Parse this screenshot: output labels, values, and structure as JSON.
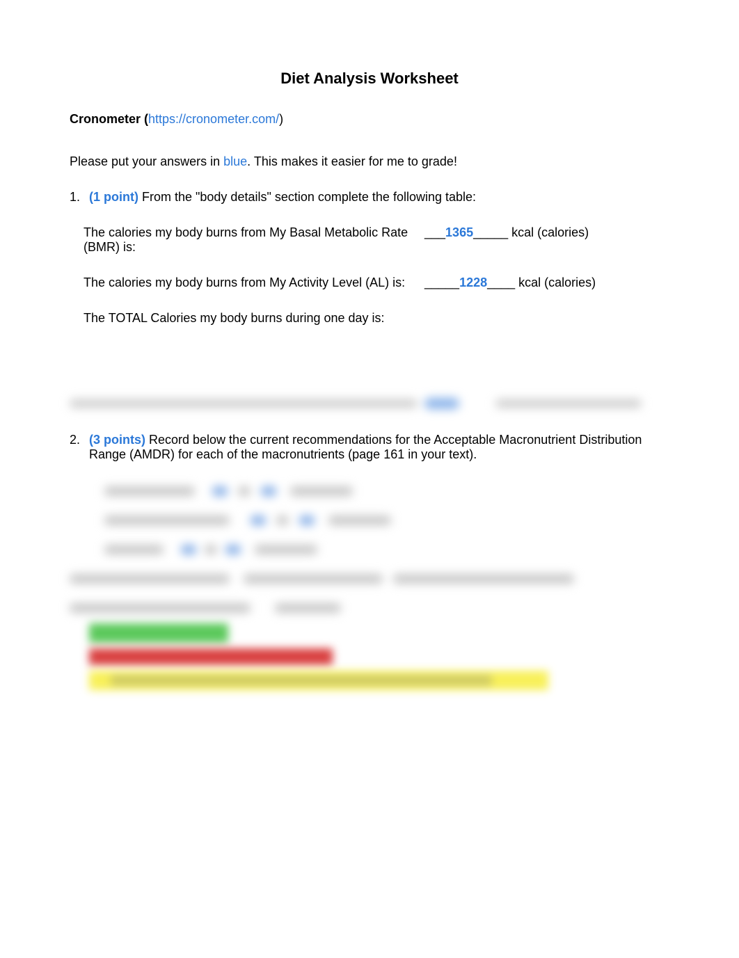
{
  "title": "Diet Analysis Worksheet",
  "cronometer": {
    "label_prefix": "Cronometer (",
    "link_text": "https://cronometer.com/",
    "label_suffix": ")"
  },
  "instruction": {
    "pre": "Please put your answers in ",
    "blue_word": "blue",
    "post": ".  This makes it easier for me to grade!"
  },
  "q1": {
    "num": "1.",
    "points_label": "(1 point)",
    "text": " From the \"body details\" section complete the following table:",
    "row1": {
      "label": "The calories my body burns from My Basal Metabolic Rate (BMR) is:",
      "pre_blank": "___",
      "value": "1365",
      "post_blank": "_____",
      "unit": " kcal (calories)"
    },
    "row2": {
      "label": "The calories my body burns from My Activity Level (AL) is:",
      "pre_blank": "_____",
      "value": "1228",
      "post_blank": "____",
      "unit": " kcal (calories)"
    },
    "row3": {
      "label": "The TOTAL Calories my body burns during one day is:"
    }
  },
  "q2": {
    "num": "2.",
    "points_label": "(3 points)",
    "text": " Record below the current recommendations for the Acceptable Macronutrient Distribution Range (AMDR) for each of the macronutrients (page 161 in your text)."
  }
}
